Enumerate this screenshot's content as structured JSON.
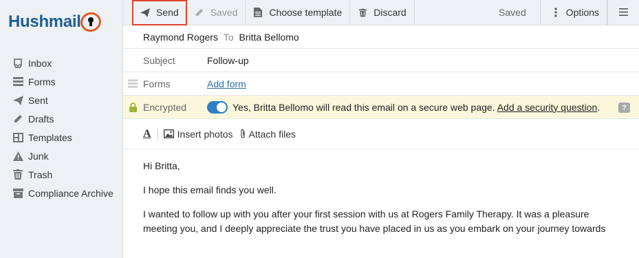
{
  "logo": {
    "text": "Hushmail"
  },
  "sidebar": {
    "items": [
      {
        "label": "Inbox",
        "icon": "inbox-icon"
      },
      {
        "label": "Forms",
        "icon": "forms-icon"
      },
      {
        "label": "Sent",
        "icon": "send-icon"
      },
      {
        "label": "Drafts",
        "icon": "pencil-icon"
      },
      {
        "label": "Templates",
        "icon": "templates-icon"
      },
      {
        "label": "Junk",
        "icon": "warning-icon"
      },
      {
        "label": "Trash",
        "icon": "trash-icon"
      },
      {
        "label": "Compliance Archive",
        "icon": "archive-icon"
      }
    ]
  },
  "toolbar": {
    "send_label": "Send",
    "saved_label": "Saved",
    "template_label": "Choose template",
    "discard_label": "Discard",
    "status": "Saved",
    "options_label": "Options"
  },
  "compose": {
    "from": "Raymond Rogers",
    "to_word": "To",
    "recipient": "Britta Bellomo",
    "subject_label": "Subject",
    "subject_value": "Follow-up",
    "forms_label": "Forms",
    "add_form": "Add form",
    "encrypted_label": "Encrypted",
    "encrypted_on": true,
    "encrypted_text": "Yes, Britta Bellomo will read this email on a secure web page.",
    "security_question": "Add a security question",
    "help": "?"
  },
  "format": {
    "font_label": "A",
    "insert_photos": "Insert photos",
    "attach_files": "Attach files"
  },
  "body": {
    "greeting": "Hi Britta,",
    "p1": "I hope this email finds you well.",
    "p2": "I wanted to follow up with you after your first session with us at Rogers Family Therapy. It was a pleasure meeting you, and I deeply appreciate the trust you have placed in us as you embark on your journey towards"
  },
  "colors": {
    "accent": "#2f7ec4",
    "send_border": "#e0432e",
    "logo_blue": "#1f5f96",
    "logo_orange": "#e2592a",
    "encrypted_bg": "#fbf7dc",
    "lock_green": "#9bb63b"
  }
}
